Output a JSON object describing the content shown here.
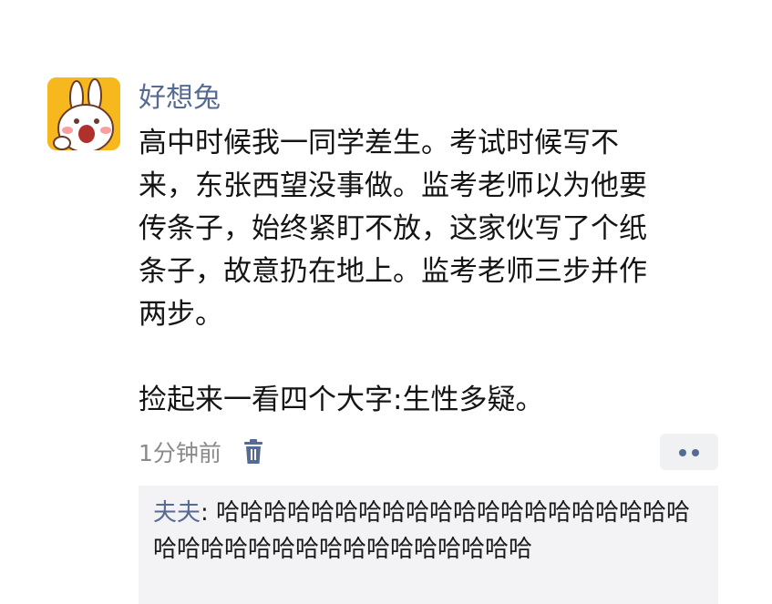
{
  "post": {
    "username": "好想兔",
    "paragraphs": [
      "高中时候我一同学差生。考试时候写不\n来，东张西望没事做。监考老师以为他要\n传条子，始终紧盯不放，这家伙写了个纸\n条子，故意扔在地上。监考老师三步并作\n两步。",
      "捡起来一看四个大字:生性多疑。"
    ],
    "timestamp": "1分钟前",
    "icons": {
      "avatar": "rabbit-avatar",
      "delete": "trash-icon",
      "more": "more-dots-icon"
    }
  },
  "comment": {
    "author": "夫夫",
    "separator": ": ",
    "text": "哈哈哈哈哈哈哈哈哈哈哈哈哈哈哈哈哈哈哈哈哈哈哈哈哈哈哈哈哈哈哈哈哈哈哈哈"
  },
  "colors": {
    "accent": "#566b94",
    "avatar_bg": "#f6b81c",
    "comment_bg": "#f3f3f5",
    "timestamp": "#8a8a8a"
  }
}
